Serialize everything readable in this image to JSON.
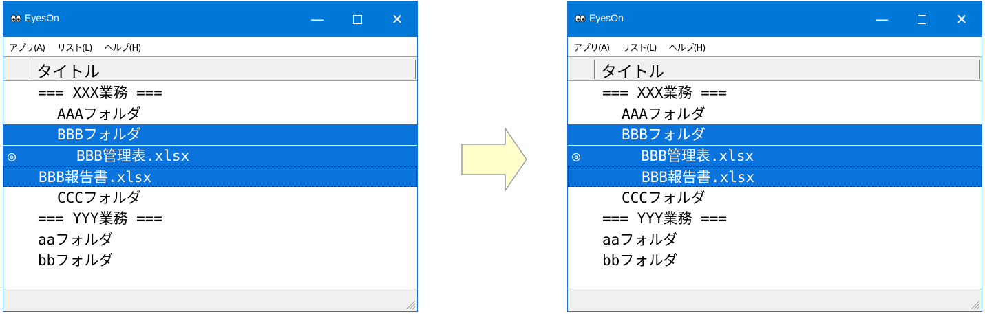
{
  "windows": [
    {
      "app_title": "EyesOn",
      "menu": [
        "アプリ(A)",
        "リスト(L)",
        "ヘルプ(H)"
      ],
      "column_title": "タイトル",
      "mark_symbol": "◎",
      "rows": [
        {
          "text": "=== XXX業務 ===",
          "indent": 1,
          "selected": false,
          "focused": false,
          "marked": false
        },
        {
          "text": "AAAフォルダ",
          "indent": 2,
          "selected": false,
          "focused": false,
          "marked": false
        },
        {
          "text": "BBBフォルダ",
          "indent": 2,
          "selected": true,
          "focused": false,
          "marked": false
        },
        {
          "text": "BBB管理表.xlsx",
          "indent": 3,
          "selected": true,
          "focused": false,
          "marked": true
        },
        {
          "text": "BBB報告書.xlsx",
          "indent": 1,
          "selected": true,
          "focused": true,
          "marked": false
        },
        {
          "text": "CCCフォルダ",
          "indent": 2,
          "selected": false,
          "focused": false,
          "marked": false
        },
        {
          "text": "=== YYY業務 ===",
          "indent": 1,
          "selected": false,
          "focused": false,
          "marked": false
        },
        {
          "text": "aaフォルダ",
          "indent": 1,
          "selected": false,
          "focused": false,
          "marked": false
        },
        {
          "text": "bbフォルダ",
          "indent": 1,
          "selected": false,
          "focused": false,
          "marked": false
        }
      ]
    },
    {
      "app_title": "EyesOn",
      "menu": [
        "アプリ(A)",
        "リスト(L)",
        "ヘルプ(H)"
      ],
      "column_title": "タイトル",
      "mark_symbol": "◎",
      "rows": [
        {
          "text": "=== XXX業務 ===",
          "indent": 1,
          "selected": false,
          "focused": false,
          "marked": false
        },
        {
          "text": "AAAフォルダ",
          "indent": 2,
          "selected": false,
          "focused": false,
          "marked": false
        },
        {
          "text": "BBBフォルダ",
          "indent": 2,
          "selected": true,
          "focused": false,
          "marked": false
        },
        {
          "text": "BBB管理表.xlsx",
          "indent": 3,
          "selected": true,
          "focused": false,
          "marked": true
        },
        {
          "text": "BBB報告書.xlsx",
          "indent": 3,
          "selected": true,
          "focused": true,
          "marked": false
        },
        {
          "text": "CCCフォルダ",
          "indent": 2,
          "selected": false,
          "focused": false,
          "marked": false
        },
        {
          "text": "=== YYY業務 ===",
          "indent": 1,
          "selected": false,
          "focused": false,
          "marked": false
        },
        {
          "text": "aaフォルダ",
          "indent": 1,
          "selected": false,
          "focused": false,
          "marked": false
        },
        {
          "text": "bbフォルダ",
          "indent": 1,
          "selected": false,
          "focused": false,
          "marked": false
        }
      ]
    }
  ],
  "colors": {
    "titlebar": "#0078d7",
    "selection": "#0a74dc",
    "arrow_fill": "#ffffcc",
    "arrow_stroke": "#9aa0a6"
  },
  "icons": {
    "app": "eyes-icon",
    "minimize": "minimize-icon",
    "maximize": "maximize-icon",
    "close": "close-icon",
    "arrow": "right-arrow-icon",
    "grip": "resize-grip-icon"
  }
}
